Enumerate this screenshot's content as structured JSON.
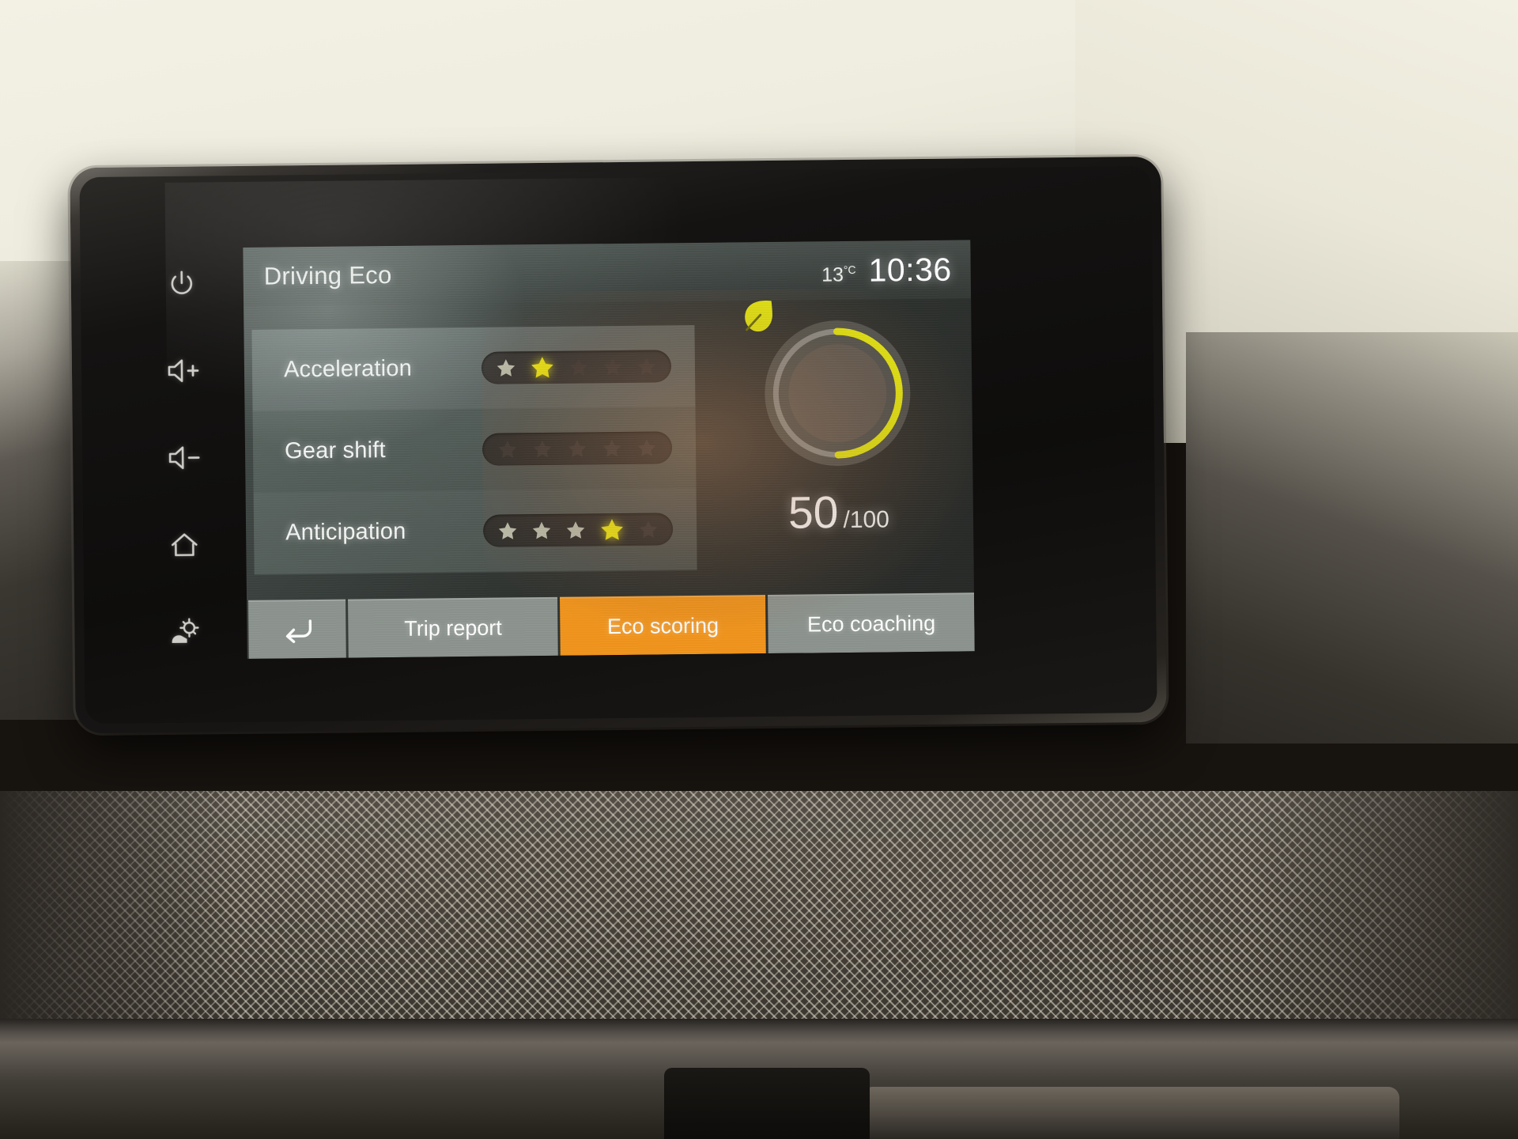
{
  "device": {
    "name": "car-infotainment-head-unit",
    "bezel_buttons": [
      {
        "name": "power-icon",
        "label": "Power"
      },
      {
        "name": "volume-up-icon",
        "label": "Volume up"
      },
      {
        "name": "volume-down-icon",
        "label": "Volume down"
      },
      {
        "name": "home-icon",
        "label": "Home"
      },
      {
        "name": "settings-icon",
        "label": "Settings"
      }
    ]
  },
  "header": {
    "title": "Driving Eco",
    "temperature": "13",
    "temperature_unit": "°C",
    "clock": "10:36"
  },
  "metrics": [
    {
      "label": "Acceleration",
      "stars": [
        "pale",
        "lit",
        "dim",
        "dim",
        "dim"
      ],
      "score": 2,
      "max": 5
    },
    {
      "label": "Gear shift",
      "stars": [
        "dim",
        "dim",
        "dim",
        "dim",
        "dim"
      ],
      "score": 0,
      "max": 5
    },
    {
      "label": "Anticipation",
      "stars": [
        "pale",
        "pale",
        "pale",
        "lit",
        "dim"
      ],
      "score": 4,
      "max": 5
    }
  ],
  "eco_score": {
    "value": "50",
    "max": "/100",
    "percent": 50,
    "icon": "leaf-icon",
    "arc_color": "#e8ec10",
    "track_color": "#8c8f8c"
  },
  "tabs": [
    {
      "name": "back-button",
      "label": "↩",
      "icon": "back-arrow-icon",
      "active": false
    },
    {
      "name": "tab-trip-report",
      "label": "Trip report",
      "active": false
    },
    {
      "name": "tab-eco-scoring",
      "label": "Eco scoring",
      "active": true
    },
    {
      "name": "tab-eco-coaching",
      "label": "Eco coaching",
      "active": false
    }
  ],
  "colors": {
    "accent_orange": "#f2951d",
    "star_lit": "#f2ef12",
    "star_pale": "#dfe4cf",
    "star_dim": "#3b3836",
    "tab_grey": "#8d948f"
  }
}
